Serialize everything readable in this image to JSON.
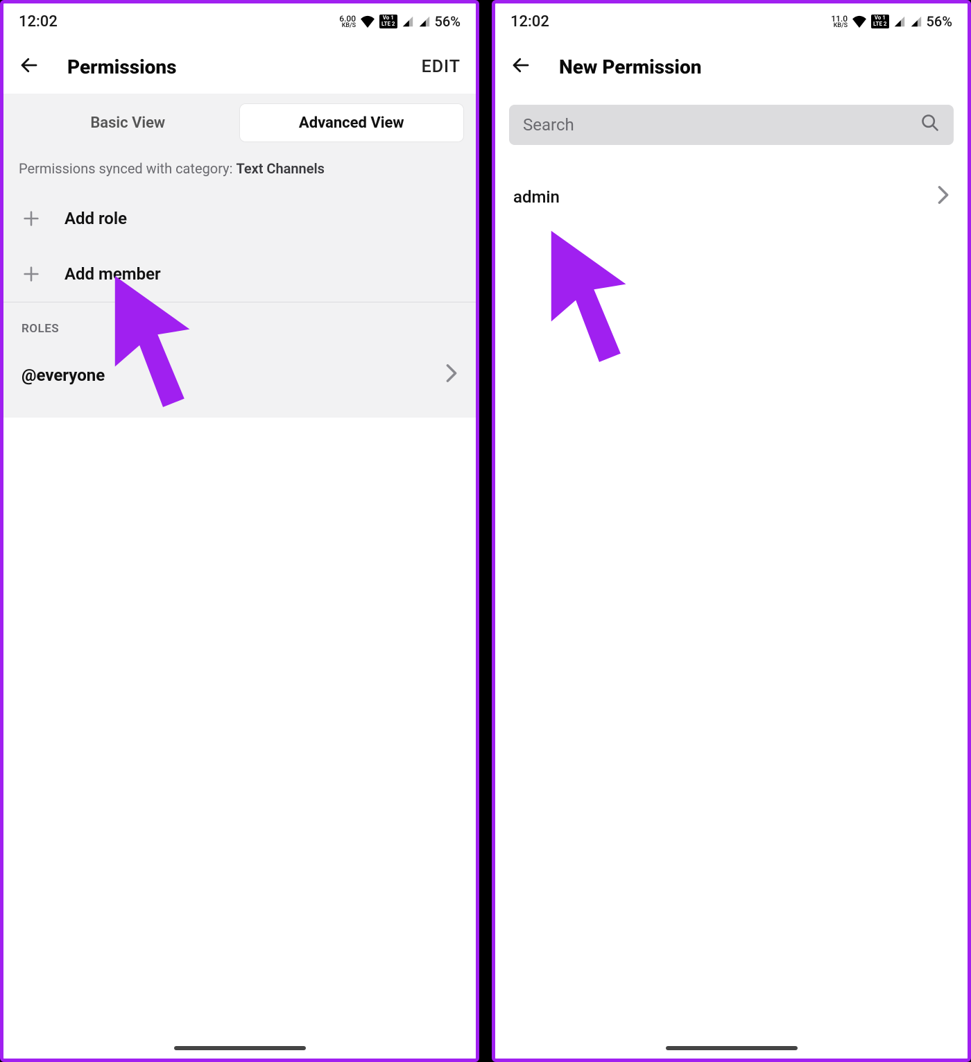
{
  "left": {
    "status": {
      "time": "12:02",
      "net_speed_top": "6.00",
      "net_speed_bot": "KB/S",
      "vo1": "Vo 1",
      "lte": "LTE 2",
      "battery": "56%"
    },
    "header": {
      "title": "Permissions",
      "edit": "EDIT"
    },
    "tabs": {
      "basic": "Basic View",
      "advanced": "Advanced View"
    },
    "sync_prefix": "Permissions synced with category: ",
    "sync_category": "Text Channels",
    "add_role": "Add role",
    "add_member": "Add member",
    "roles_header": "ROLES",
    "role_everyone": "@everyone"
  },
  "right": {
    "status": {
      "time": "12:02",
      "net_speed_top": "11.0",
      "net_speed_bot": "KB/S",
      "vo1": "Vo 1",
      "lte": "LTE 2",
      "battery": "56%"
    },
    "header": {
      "title": "New Permission"
    },
    "search_placeholder": "Search",
    "result": "admin"
  }
}
